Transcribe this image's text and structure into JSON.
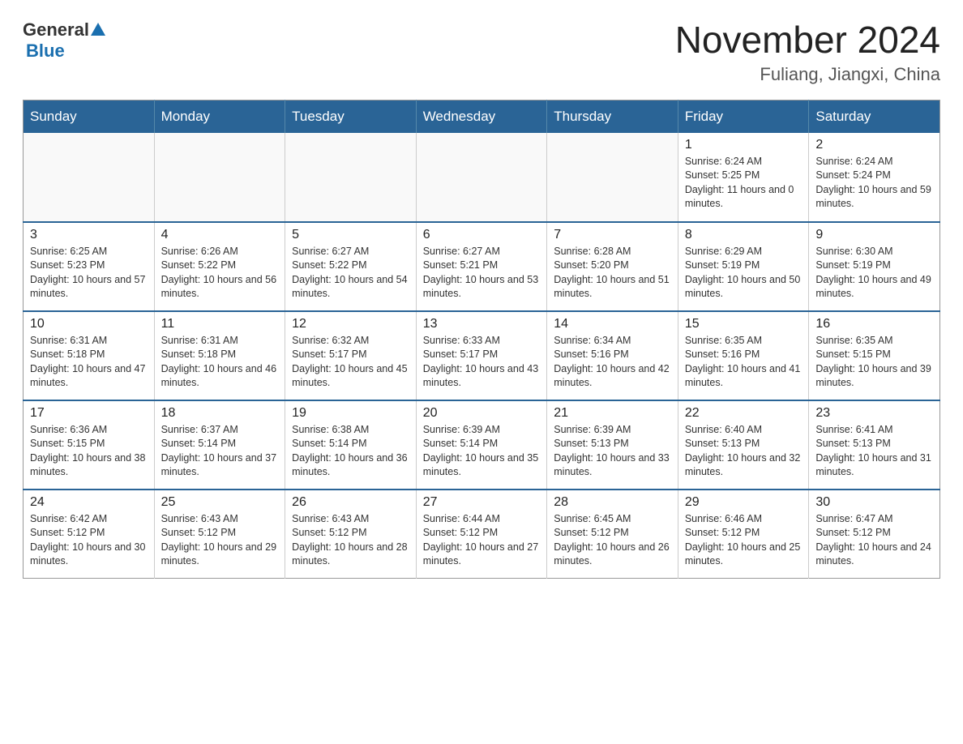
{
  "header": {
    "logo_general": "General",
    "logo_blue": "Blue",
    "month_title": "November 2024",
    "location": "Fuliang, Jiangxi, China"
  },
  "days_of_week": [
    "Sunday",
    "Monday",
    "Tuesday",
    "Wednesday",
    "Thursday",
    "Friday",
    "Saturday"
  ],
  "weeks": [
    [
      {
        "day": "",
        "info": ""
      },
      {
        "day": "",
        "info": ""
      },
      {
        "day": "",
        "info": ""
      },
      {
        "day": "",
        "info": ""
      },
      {
        "day": "",
        "info": ""
      },
      {
        "day": "1",
        "info": "Sunrise: 6:24 AM\nSunset: 5:25 PM\nDaylight: 11 hours and 0 minutes."
      },
      {
        "day": "2",
        "info": "Sunrise: 6:24 AM\nSunset: 5:24 PM\nDaylight: 10 hours and 59 minutes."
      }
    ],
    [
      {
        "day": "3",
        "info": "Sunrise: 6:25 AM\nSunset: 5:23 PM\nDaylight: 10 hours and 57 minutes."
      },
      {
        "day": "4",
        "info": "Sunrise: 6:26 AM\nSunset: 5:22 PM\nDaylight: 10 hours and 56 minutes."
      },
      {
        "day": "5",
        "info": "Sunrise: 6:27 AM\nSunset: 5:22 PM\nDaylight: 10 hours and 54 minutes."
      },
      {
        "day": "6",
        "info": "Sunrise: 6:27 AM\nSunset: 5:21 PM\nDaylight: 10 hours and 53 minutes."
      },
      {
        "day": "7",
        "info": "Sunrise: 6:28 AM\nSunset: 5:20 PM\nDaylight: 10 hours and 51 minutes."
      },
      {
        "day": "8",
        "info": "Sunrise: 6:29 AM\nSunset: 5:19 PM\nDaylight: 10 hours and 50 minutes."
      },
      {
        "day": "9",
        "info": "Sunrise: 6:30 AM\nSunset: 5:19 PM\nDaylight: 10 hours and 49 minutes."
      }
    ],
    [
      {
        "day": "10",
        "info": "Sunrise: 6:31 AM\nSunset: 5:18 PM\nDaylight: 10 hours and 47 minutes."
      },
      {
        "day": "11",
        "info": "Sunrise: 6:31 AM\nSunset: 5:18 PM\nDaylight: 10 hours and 46 minutes."
      },
      {
        "day": "12",
        "info": "Sunrise: 6:32 AM\nSunset: 5:17 PM\nDaylight: 10 hours and 45 minutes."
      },
      {
        "day": "13",
        "info": "Sunrise: 6:33 AM\nSunset: 5:17 PM\nDaylight: 10 hours and 43 minutes."
      },
      {
        "day": "14",
        "info": "Sunrise: 6:34 AM\nSunset: 5:16 PM\nDaylight: 10 hours and 42 minutes."
      },
      {
        "day": "15",
        "info": "Sunrise: 6:35 AM\nSunset: 5:16 PM\nDaylight: 10 hours and 41 minutes."
      },
      {
        "day": "16",
        "info": "Sunrise: 6:35 AM\nSunset: 5:15 PM\nDaylight: 10 hours and 39 minutes."
      }
    ],
    [
      {
        "day": "17",
        "info": "Sunrise: 6:36 AM\nSunset: 5:15 PM\nDaylight: 10 hours and 38 minutes."
      },
      {
        "day": "18",
        "info": "Sunrise: 6:37 AM\nSunset: 5:14 PM\nDaylight: 10 hours and 37 minutes."
      },
      {
        "day": "19",
        "info": "Sunrise: 6:38 AM\nSunset: 5:14 PM\nDaylight: 10 hours and 36 minutes."
      },
      {
        "day": "20",
        "info": "Sunrise: 6:39 AM\nSunset: 5:14 PM\nDaylight: 10 hours and 35 minutes."
      },
      {
        "day": "21",
        "info": "Sunrise: 6:39 AM\nSunset: 5:13 PM\nDaylight: 10 hours and 33 minutes."
      },
      {
        "day": "22",
        "info": "Sunrise: 6:40 AM\nSunset: 5:13 PM\nDaylight: 10 hours and 32 minutes."
      },
      {
        "day": "23",
        "info": "Sunrise: 6:41 AM\nSunset: 5:13 PM\nDaylight: 10 hours and 31 minutes."
      }
    ],
    [
      {
        "day": "24",
        "info": "Sunrise: 6:42 AM\nSunset: 5:12 PM\nDaylight: 10 hours and 30 minutes."
      },
      {
        "day": "25",
        "info": "Sunrise: 6:43 AM\nSunset: 5:12 PM\nDaylight: 10 hours and 29 minutes."
      },
      {
        "day": "26",
        "info": "Sunrise: 6:43 AM\nSunset: 5:12 PM\nDaylight: 10 hours and 28 minutes."
      },
      {
        "day": "27",
        "info": "Sunrise: 6:44 AM\nSunset: 5:12 PM\nDaylight: 10 hours and 27 minutes."
      },
      {
        "day": "28",
        "info": "Sunrise: 6:45 AM\nSunset: 5:12 PM\nDaylight: 10 hours and 26 minutes."
      },
      {
        "day": "29",
        "info": "Sunrise: 6:46 AM\nSunset: 5:12 PM\nDaylight: 10 hours and 25 minutes."
      },
      {
        "day": "30",
        "info": "Sunrise: 6:47 AM\nSunset: 5:12 PM\nDaylight: 10 hours and 24 minutes."
      }
    ]
  ]
}
